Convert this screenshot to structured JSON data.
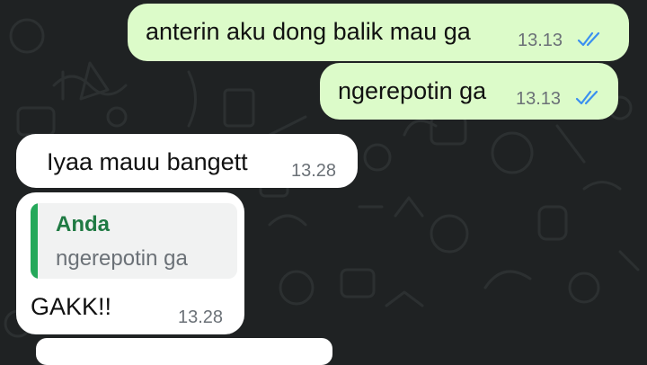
{
  "colors": {
    "outgoing_bubble": "#dcfbc9",
    "incoming_bubble": "#ffffff",
    "wallpaper": "#1f2223",
    "read_ticks": "#3a8ff0",
    "quote_accent": "#25a85a",
    "quote_author": "#1f7a43"
  },
  "messages": [
    {
      "direction": "outgoing",
      "text": "anterin aku dong balik mau ga",
      "time": "13.13",
      "status": "read",
      "status_icon": "double-check-icon"
    },
    {
      "direction": "outgoing",
      "text": "ngerepotin ga",
      "time": "13.13",
      "status": "read",
      "status_icon": "double-check-icon"
    },
    {
      "direction": "incoming",
      "text": "Iyaa mauu bangett",
      "time": "13.28"
    },
    {
      "direction": "incoming",
      "reply_to": {
        "author": "Anda",
        "text": "ngerepotin ga"
      },
      "text": "GAKK!!",
      "time": "13.28"
    }
  ]
}
